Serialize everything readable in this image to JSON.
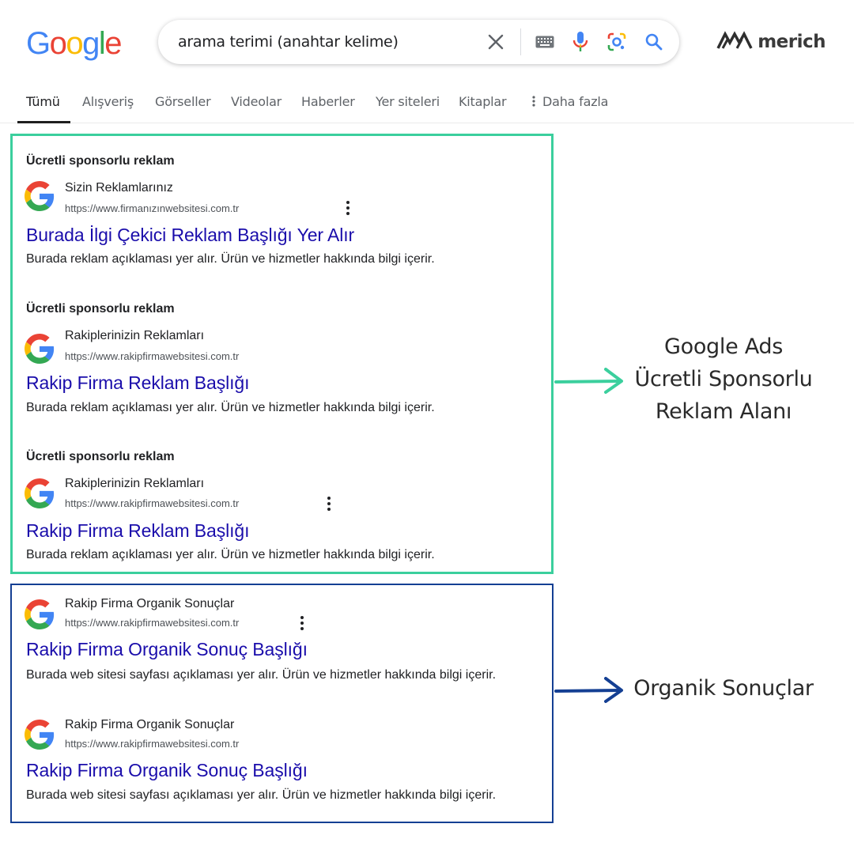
{
  "header": {
    "logo_letters": [
      {
        "char": "G",
        "color": "#4285F4"
      },
      {
        "char": "o",
        "color": "#EA4335"
      },
      {
        "char": "o",
        "color": "#FBBC05"
      },
      {
        "char": "g",
        "color": "#4285F4"
      },
      {
        "char": "l",
        "color": "#34A853"
      },
      {
        "char": "e",
        "color": "#EA4335"
      }
    ],
    "search_query": "arama terimi (anahtar kelime)",
    "icons": [
      "close-icon",
      "keyboard-icon",
      "microphone-icon",
      "lens-camera-icon",
      "search-icon"
    ],
    "brand": "merich"
  },
  "tabs": [
    {
      "label": "Tümü",
      "active": true
    },
    {
      "label": "Alışveriş"
    },
    {
      "label": "Görseller"
    },
    {
      "label": "Videolar"
    },
    {
      "label": "Haberler"
    },
    {
      "label": "Yer siteleri"
    },
    {
      "label": "Kitaplar"
    },
    {
      "label": "Daha fazla"
    }
  ],
  "ads": [
    {
      "sponsor_label": "Ücretli sponsorlu reklam",
      "site_name": "Sizin Reklamlarınız",
      "url": "https://www.firmanızınwebsitesi.com.tr",
      "title": "Burada İlgi Çekici Reklam Başlığı Yer Alır",
      "description": "Burada reklam açıklaması yer alır. Ürün ve hizmetler hakkında bilgi içerir."
    },
    {
      "sponsor_label": "Ücretli sponsorlu reklam",
      "site_name": "Rakiplerinizin Reklamları",
      "url": "https://www.rakipfirmawebsitesi.com.tr",
      "title": "Rakip Firma Reklam Başlığı",
      "description": "Burada reklam açıklaması yer alır. Ürün ve hizmetler hakkında bilgi içerir."
    },
    {
      "sponsor_label": "Ücretli sponsorlu reklam",
      "site_name": "Rakiplerinizin Reklamları",
      "url": "https://www.rakipfirmawebsitesi.com.tr",
      "title": "Rakip Firma Reklam Başlığı",
      "description": "Burada reklam açıklaması yer alır. Ürün ve hizmetler hakkında bilgi içerir."
    }
  ],
  "organic": [
    {
      "site_name": "Rakip Firma Organik Sonuçlar",
      "url": "https://www.rakipfirmawebsitesi.com.tr",
      "title": "Rakip Firma Organik Sonuç Başlığı",
      "description": "Burada web sitesi sayfası açıklaması yer alır. Ürün ve hizmetler hakkında bilgi içerir."
    },
    {
      "site_name": "Rakip Firma Organik Sonuçlar",
      "url": "https://www.rakipfirmawebsitesi.com.tr",
      "title": "Rakip Firma Organik Sonuç Başlığı",
      "description": "Burada web sitesi sayfası açıklaması yer alır. Ürün ve hizmetler hakkında bilgi içerir."
    }
  ],
  "annotations": {
    "ads_lines": [
      "Google Ads",
      "Ücretli Sponsorlu",
      "Reklam Alanı"
    ],
    "organic_label": "Organik Sonuçlar"
  },
  "colors": {
    "ads_border": "#3bcf9d",
    "organic_border": "#143f93",
    "link_title": "#1a0dab"
  }
}
